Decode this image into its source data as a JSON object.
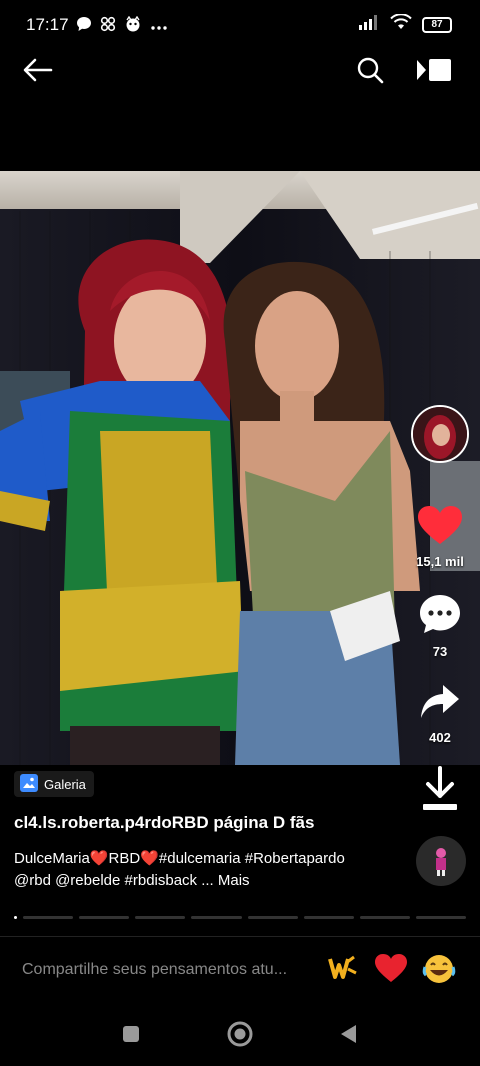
{
  "status": {
    "time": "17:17",
    "battery": "87",
    "left_icons": [
      "chat-icon",
      "apps-icon",
      "assistant-icon",
      "more-icon"
    ],
    "right_icons": [
      "signal-icon",
      "wifi-icon",
      "battery-icon"
    ]
  },
  "top_bar": {
    "icons": [
      "back-arrow-icon",
      "search-icon",
      "video-mode-icon"
    ]
  },
  "post": {
    "source_label": "Galeria",
    "author": "cl4.ls.roberta.p4rdoRBD página D fãs",
    "caption_line1": "DulceMaria❤️RBD❤️#dulcemaria #Robertapardo",
    "caption_line2": "@rbd @rebelde #rbdisback ... Mais",
    "likes": "15,1 mil",
    "comments": "73",
    "shares": "402"
  },
  "comment_bar": {
    "placeholder": "Compartilhe seus pensamentos atu...",
    "quick_emojis": [
      "🔥",
      "❤️",
      "😂"
    ]
  },
  "colors": {
    "like": "#ff2d3a",
    "placeholder": "#888888",
    "background": "#000000"
  }
}
